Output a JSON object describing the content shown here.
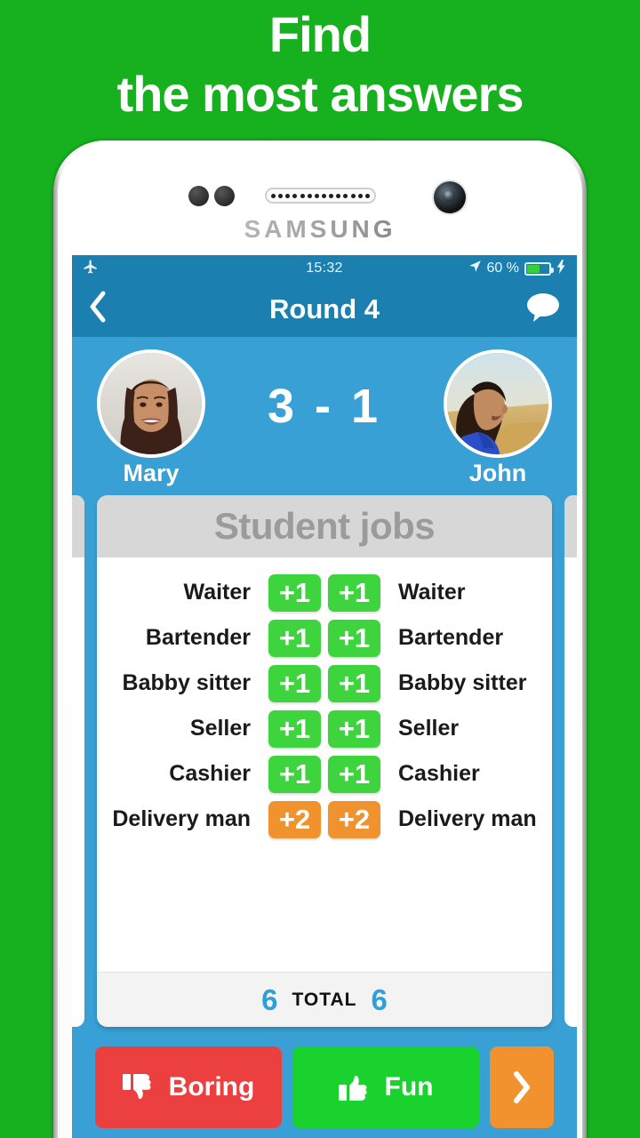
{
  "promo": {
    "line1": "Find",
    "line2": "the most answers"
  },
  "device": {
    "brand": "SAMSUNG"
  },
  "status_bar": {
    "airplane_icon": "airplane-icon",
    "time": "15:32",
    "location_icon": "location-arrow-icon",
    "battery_percent": "60 %",
    "battery_level": 60,
    "charging_icon": "lightning-bolt-icon"
  },
  "nav_bar": {
    "back_icon": "chevron-left-icon",
    "title": "Round 4",
    "chat_icon": "speech-bubble-icon"
  },
  "scoreboard": {
    "left_player": {
      "name": "Mary",
      "score": "3"
    },
    "separator": "-",
    "right_player": {
      "name": "John",
      "score": "1"
    },
    "score_display": "3 - 1"
  },
  "card": {
    "title": "Student jobs",
    "rows": [
      {
        "left_label": "Waiter",
        "left_badge": "+1",
        "left_color": "green",
        "right_badge": "+1",
        "right_color": "green",
        "right_label": "Waiter"
      },
      {
        "left_label": "Bartender",
        "left_badge": "+1",
        "left_color": "green",
        "right_badge": "+1",
        "right_color": "green",
        "right_label": "Bartender"
      },
      {
        "left_label": "Babby sitter",
        "left_badge": "+1",
        "left_color": "green",
        "right_badge": "+1",
        "right_color": "green",
        "right_label": "Babby sitter"
      },
      {
        "left_label": "Seller",
        "left_badge": "+1",
        "left_color": "green",
        "right_badge": "+1",
        "right_color": "green",
        "right_label": "Seller"
      },
      {
        "left_label": "Cashier",
        "left_badge": "+1",
        "left_color": "green",
        "right_badge": "+1",
        "right_color": "green",
        "right_label": "Cashier"
      },
      {
        "left_label": "Delivery man",
        "left_badge": "+2",
        "left_color": "orange",
        "right_badge": "+2",
        "right_color": "orange",
        "right_label": "Delivery man"
      }
    ],
    "footer": {
      "left_total": "6",
      "label": "TOTAL",
      "right_total": "6"
    }
  },
  "actions": {
    "boring_label": "Boring",
    "boring_icon": "thumbs-down-icon",
    "fun_label": "Fun",
    "fun_icon": "thumbs-up-icon",
    "next_icon": "chevron-right-icon"
  },
  "colors": {
    "background_green": "#17b01e",
    "nav_blue": "#1b7fb0",
    "screen_blue": "#38a0d4",
    "badge_green": "#3ed43e",
    "badge_orange": "#f0922e",
    "boring_red": "#ec4040",
    "fun_green": "#19d22e",
    "next_orange": "#f2922f",
    "total_blue": "#2f9fd8"
  }
}
